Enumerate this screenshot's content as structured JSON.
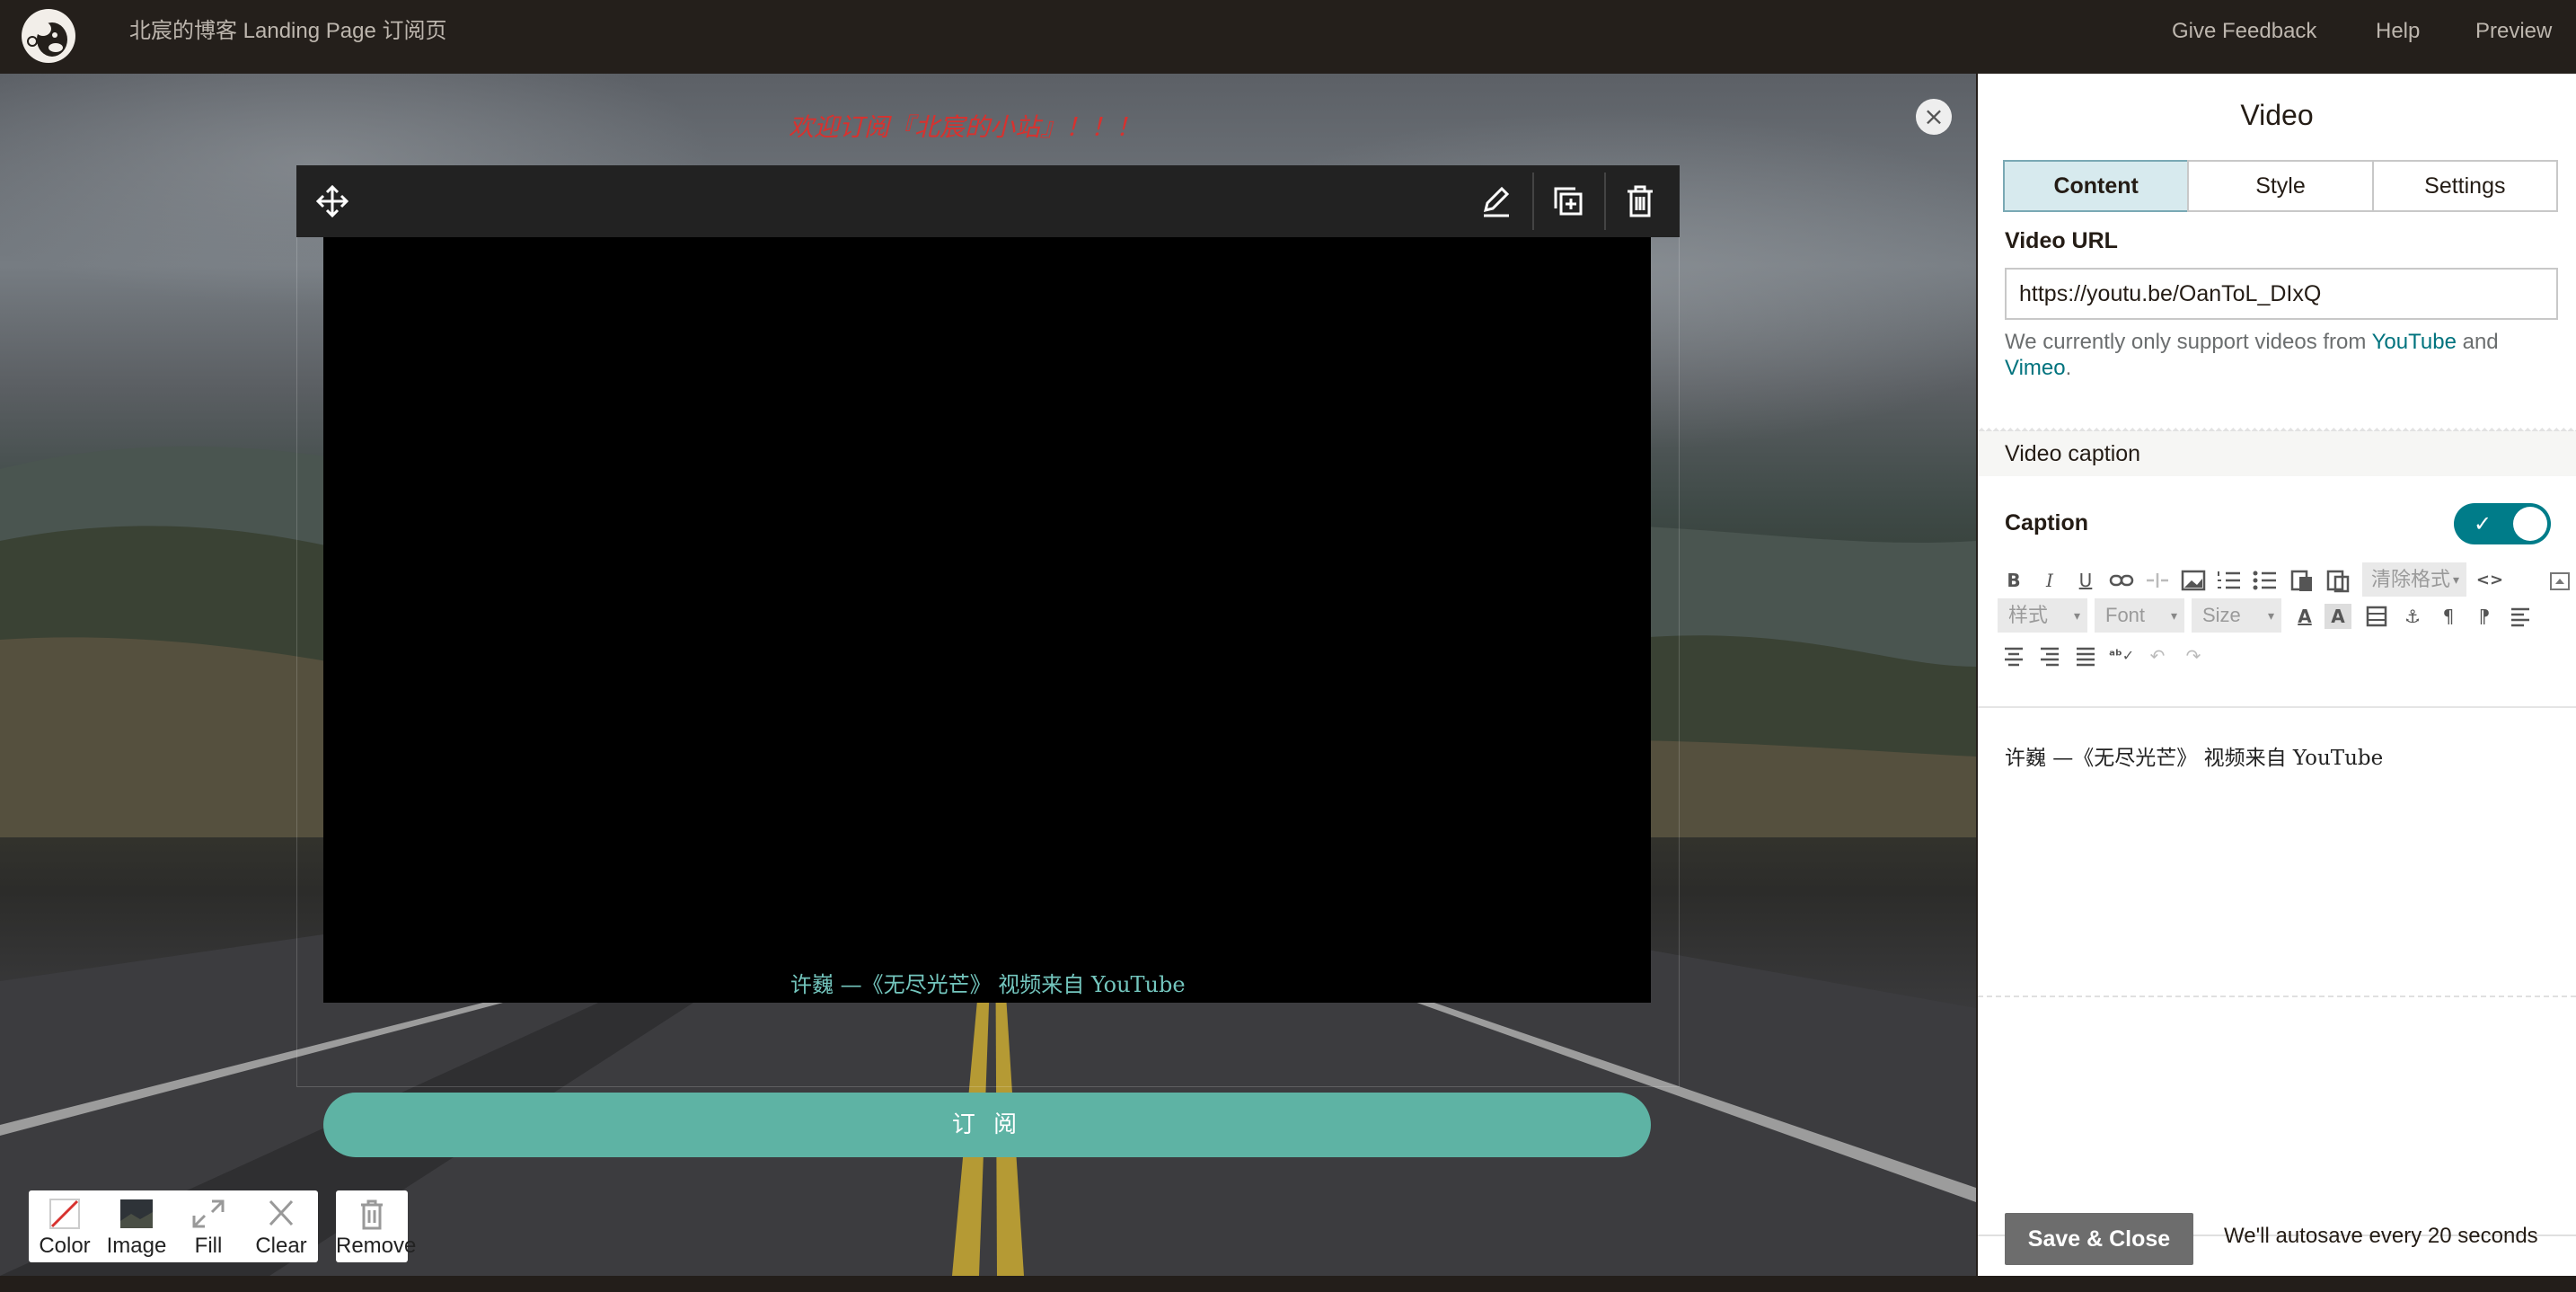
{
  "topbar": {
    "doc_title": "北宸的博客 Landing Page 订阅页",
    "links": [
      "Give Feedback",
      "Help",
      "Preview"
    ]
  },
  "canvas": {
    "welcome_text": "欢迎订阅『北宸的小站』！！！",
    "close_glyph": "×",
    "video_caption": "许巍  —《无尽光芒》   视频来自 YouTube",
    "subscribe_label": "订 阅",
    "bg_tools": [
      {
        "label": "Color",
        "icon": "color-swatch-icon"
      },
      {
        "label": "Image",
        "icon": "image-thumbnail-icon"
      },
      {
        "label": "Fill",
        "icon": "expand-arrows-icon"
      },
      {
        "label": "Clear",
        "icon": "clear-x-icon"
      },
      {
        "label": "Remove",
        "icon": "trash-icon"
      }
    ],
    "block_toolbar_icons": [
      "move-icon",
      "edit-pencil-icon",
      "duplicate-icon",
      "delete-trash-icon"
    ]
  },
  "panel": {
    "title": "Video",
    "tabs": [
      {
        "label": "Content",
        "active": true
      },
      {
        "label": "Style",
        "active": false
      },
      {
        "label": "Settings",
        "active": false
      }
    ],
    "video_url_label": "Video URL",
    "video_url_value": "https://youtu.be/OanToL_DIxQ",
    "help_prefix": "We currently only support videos from ",
    "help_youtube": "YouTube",
    "help_and": " and ",
    "help_vimeo": "Vimeo",
    "help_suffix": ".",
    "caption_section": "Video caption",
    "caption_label": "Caption",
    "caption_enabled": true,
    "toggle_check": "✓",
    "editor": {
      "clear_format": "清除格式",
      "style_dropdown": "样式",
      "font_dropdown": "Font",
      "size_dropdown": "Size",
      "content": "许巍  —《无尽光芒》   视频来自 YouTube"
    },
    "save_label": "Save & Close",
    "autosave_text": "We'll autosave every 20 seconds"
  },
  "colors": {
    "topbar": "#241f1b",
    "accent_teal": "#007c89",
    "subscribe_button": "#5eb3a4",
    "welcome_red": "#d7322f",
    "caption_teal": "#73c5bd"
  }
}
